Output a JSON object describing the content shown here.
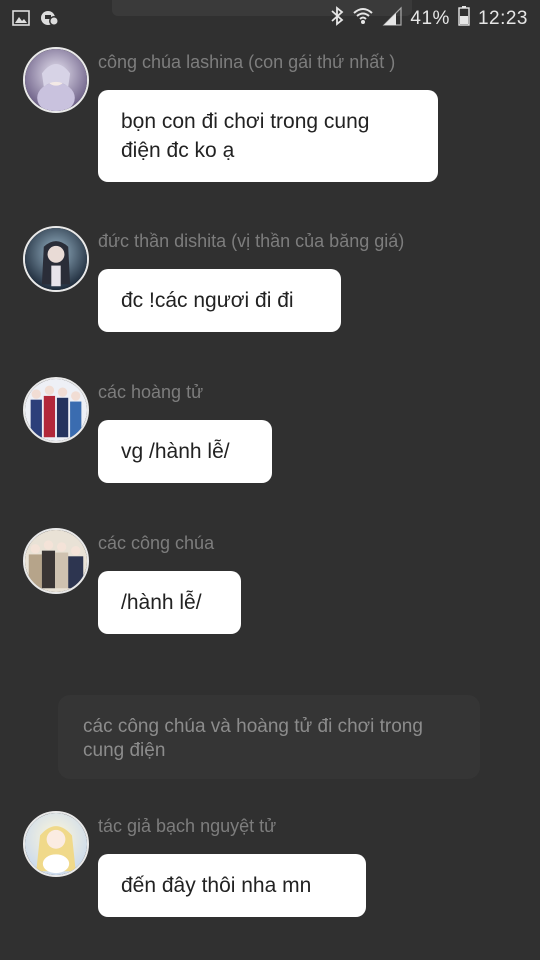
{
  "status_bar": {
    "battery_percent": "41%",
    "time": "12:23",
    "left_icons": [
      "image-icon",
      "notification-icon"
    ],
    "right_icons": [
      "bluetooth-icon",
      "wifi-icon",
      "signal-icon",
      "battery-icon"
    ]
  },
  "messages": [
    {
      "sender": "công chúa lashina (con gái thứ nhất )",
      "text": "bọn con đi chơi  trong cung\nđiện đc ko ạ"
    },
    {
      "sender": "đức thần dishita (vị thần của băng giá)",
      "text": "đc !các ngươi đi đi"
    },
    {
      "sender": "các hoàng tử",
      "text": "vg /hành lễ/"
    },
    {
      "sender": "các công chúa",
      "text": "/hành lễ/"
    },
    {
      "sender": "tác giả bạch nguyệt tử",
      "text": "đến đây thôi nha  mn"
    }
  ],
  "narration": "các công chúa và hoàng tử đi chơi trong cung điện",
  "colors": {
    "background": "#303030",
    "bubble": "#ffffff",
    "sender_text": "#7d7d7d",
    "narration_bg": "#353535"
  }
}
